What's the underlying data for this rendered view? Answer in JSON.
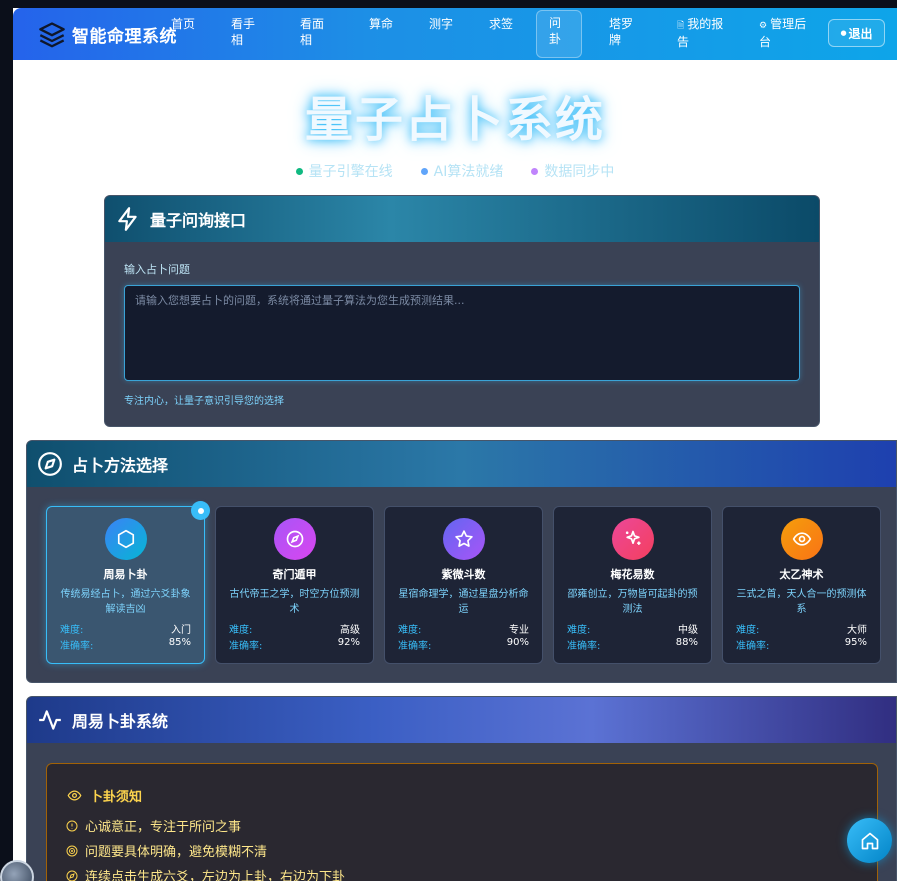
{
  "nav": {
    "brand": "智能命理系统",
    "items": [
      {
        "label": "首页"
      },
      {
        "label": "看手相"
      },
      {
        "label": "看面相"
      },
      {
        "label": "算命"
      },
      {
        "label": "测字"
      },
      {
        "label": "求签"
      },
      {
        "label": "问卦",
        "active": true
      },
      {
        "label": "塔罗牌"
      },
      {
        "label": "我的报告",
        "icon": "document-icon"
      },
      {
        "label": "管理后台",
        "icon": "gear-icon"
      }
    ],
    "logout": "退出"
  },
  "hero": {
    "title": "量子占卜系统",
    "status": [
      {
        "label": "量子引擎在线",
        "color": "#10b981"
      },
      {
        "label": "AI算法就绪",
        "color": "#60a5fa"
      },
      {
        "label": "数据同步中",
        "color": "#c084fc"
      }
    ]
  },
  "query": {
    "title": "量子问询接口",
    "label": "输入占卜问题",
    "placeholder": "请输入您想要占卜的问题，系统将通过量子算法为您生成预测结果...",
    "hint": "专注内心，让量子意识引导您的选择"
  },
  "methods": {
    "title": "占卜方法选择",
    "difficulty_label": "难度:",
    "accuracy_label": "准确率:",
    "cards": [
      {
        "name": "周易卜卦",
        "desc": "传统易经占卜，通过六爻卦象解读吉凶",
        "difficulty": "入门",
        "accuracy": "85%",
        "icon": "hexagon-icon",
        "color": "#3b82f6",
        "selected": true
      },
      {
        "name": "奇门遁甲",
        "desc": "古代帝王之学，时空方位预测术",
        "difficulty": "高级",
        "accuracy": "92%",
        "icon": "compass-icon",
        "color": "#a855f7"
      },
      {
        "name": "紫微斗数",
        "desc": "星宿命理学，通过星盘分析命运",
        "difficulty": "专业",
        "accuracy": "90%",
        "icon": "star-icon",
        "color": "#8b5cf6"
      },
      {
        "name": "梅花易数",
        "desc": "邵雍创立，万物皆可起卦的预测法",
        "difficulty": "中级",
        "accuracy": "88%",
        "icon": "sparkle-icon",
        "color": "#ec4899"
      },
      {
        "name": "太乙神术",
        "desc": "三式之首，天人合一的预测体系",
        "difficulty": "大师",
        "accuracy": "95%",
        "icon": "eye-icon",
        "color": "#f59e0b"
      }
    ]
  },
  "zhouyi": {
    "title": "周易卜卦系统",
    "notice_title": "卜卦须知",
    "notices": [
      "心诚意正，专注于所问之事",
      "问题要具体明确，避免模糊不清",
      "连续点击生成六爻，左边为上卦，右边为下卦"
    ]
  }
}
